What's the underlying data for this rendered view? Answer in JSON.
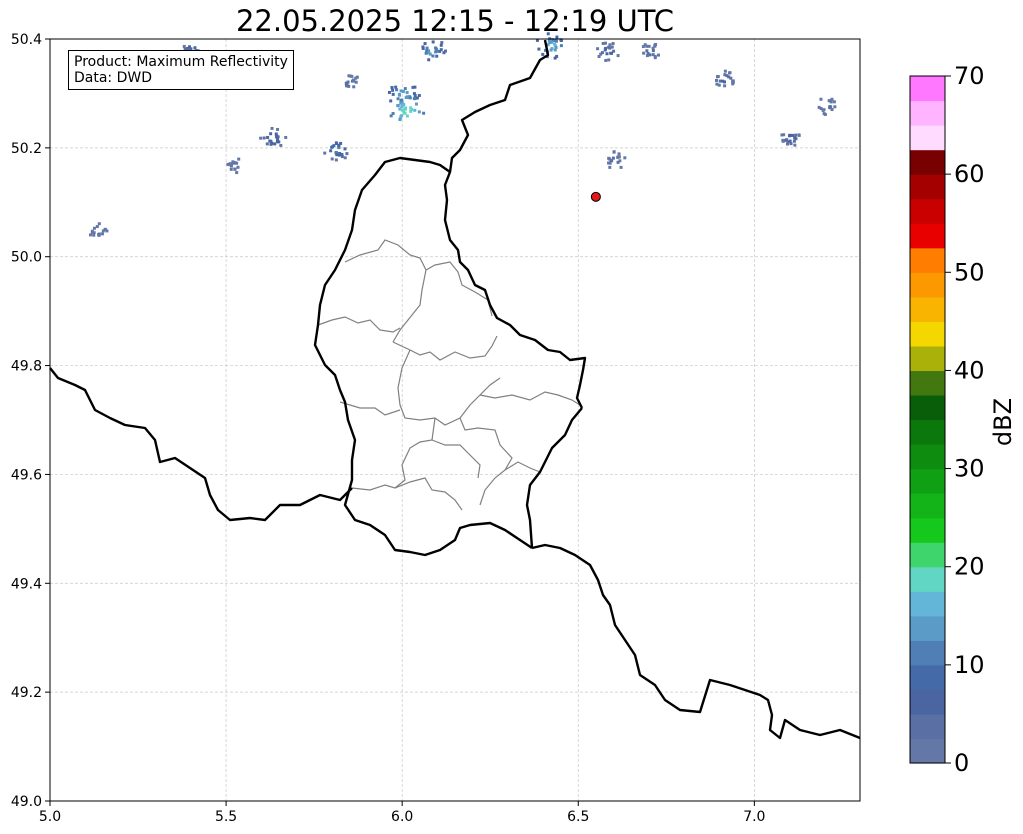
{
  "title": "22.05.2025 12:15 - 12:19 UTC",
  "info_box": {
    "product": "Product: Maximum Reflectivity",
    "data": "Data: DWD"
  },
  "map": {
    "lon_range": [
      5.0,
      7.3
    ],
    "lat_range": [
      49.0,
      50.4
    ],
    "x_ticks": [
      5.0,
      5.5,
      6.0,
      6.5,
      7.0
    ],
    "y_ticks": [
      49.0,
      49.2,
      49.4,
      49.6,
      49.8,
      50.0,
      50.2,
      50.4
    ],
    "x_tick_labels": [
      "5.0",
      "5.5",
      "6.0",
      "6.5",
      "7.0"
    ],
    "y_tick_labels": [
      "49.0",
      "49.2",
      "49.4",
      "49.6",
      "49.8",
      "50.0",
      "50.2",
      "50.4"
    ],
    "grid": true,
    "marker": {
      "lon": 6.55,
      "lat": 50.11,
      "color": "#e31a1c"
    },
    "colors": {
      "country_border": "#000000",
      "canton_border": "#808080",
      "grid": "#c8c8c8"
    },
    "radar_echoes": [
      {
        "lon": 6.0,
        "lat": 50.3,
        "dbz": 18
      },
      {
        "lon": 6.01,
        "lat": 50.27,
        "dbz": 22
      },
      {
        "lon": 5.81,
        "lat": 50.2,
        "dbz": 14
      },
      {
        "lon": 5.63,
        "lat": 50.22,
        "dbz": 12
      },
      {
        "lon": 6.08,
        "lat": 50.38,
        "dbz": 16
      },
      {
        "lon": 6.42,
        "lat": 50.39,
        "dbz": 18
      },
      {
        "lon": 6.58,
        "lat": 50.38,
        "dbz": 10
      },
      {
        "lon": 6.7,
        "lat": 50.38,
        "dbz": 8
      },
      {
        "lon": 6.91,
        "lat": 50.33,
        "dbz": 10
      },
      {
        "lon": 7.1,
        "lat": 50.22,
        "dbz": 10
      },
      {
        "lon": 7.2,
        "lat": 50.28,
        "dbz": 8
      },
      {
        "lon": 5.13,
        "lat": 50.05,
        "dbz": 6
      },
      {
        "lon": 5.52,
        "lat": 50.17,
        "dbz": 6
      },
      {
        "lon": 5.4,
        "lat": 50.38,
        "dbz": 12
      },
      {
        "lon": 5.85,
        "lat": 50.32,
        "dbz": 8
      },
      {
        "lon": 6.6,
        "lat": 50.18,
        "dbz": 8
      }
    ]
  },
  "colorbar": {
    "label": "dBZ",
    "min": 0,
    "max": 70,
    "step": 2.5,
    "ticks": [
      0,
      10,
      20,
      30,
      40,
      50,
      60,
      70
    ],
    "tick_labels": [
      "0",
      "10",
      "20",
      "30",
      "40",
      "50",
      "60",
      "70"
    ],
    "colors": [
      "#6478a8",
      "#5a6fa4",
      "#4a65a2",
      "#446aa8",
      "#4f7fb4",
      "#5a9cc7",
      "#63b6d7",
      "#62d6c4",
      "#3ed66c",
      "#14c81c",
      "#12b418",
      "#10a014",
      "#0d8c10",
      "#0b780c",
      "#095f09",
      "#437811",
      "#aab20a",
      "#f5d700",
      "#f8b400",
      "#fc9900",
      "#ff7d00",
      "#e80000",
      "#c80000",
      "#a50000",
      "#780000",
      "#ffdcff",
      "#ffb4ff",
      "#ff78ff",
      "#f03cf0"
    ]
  }
}
